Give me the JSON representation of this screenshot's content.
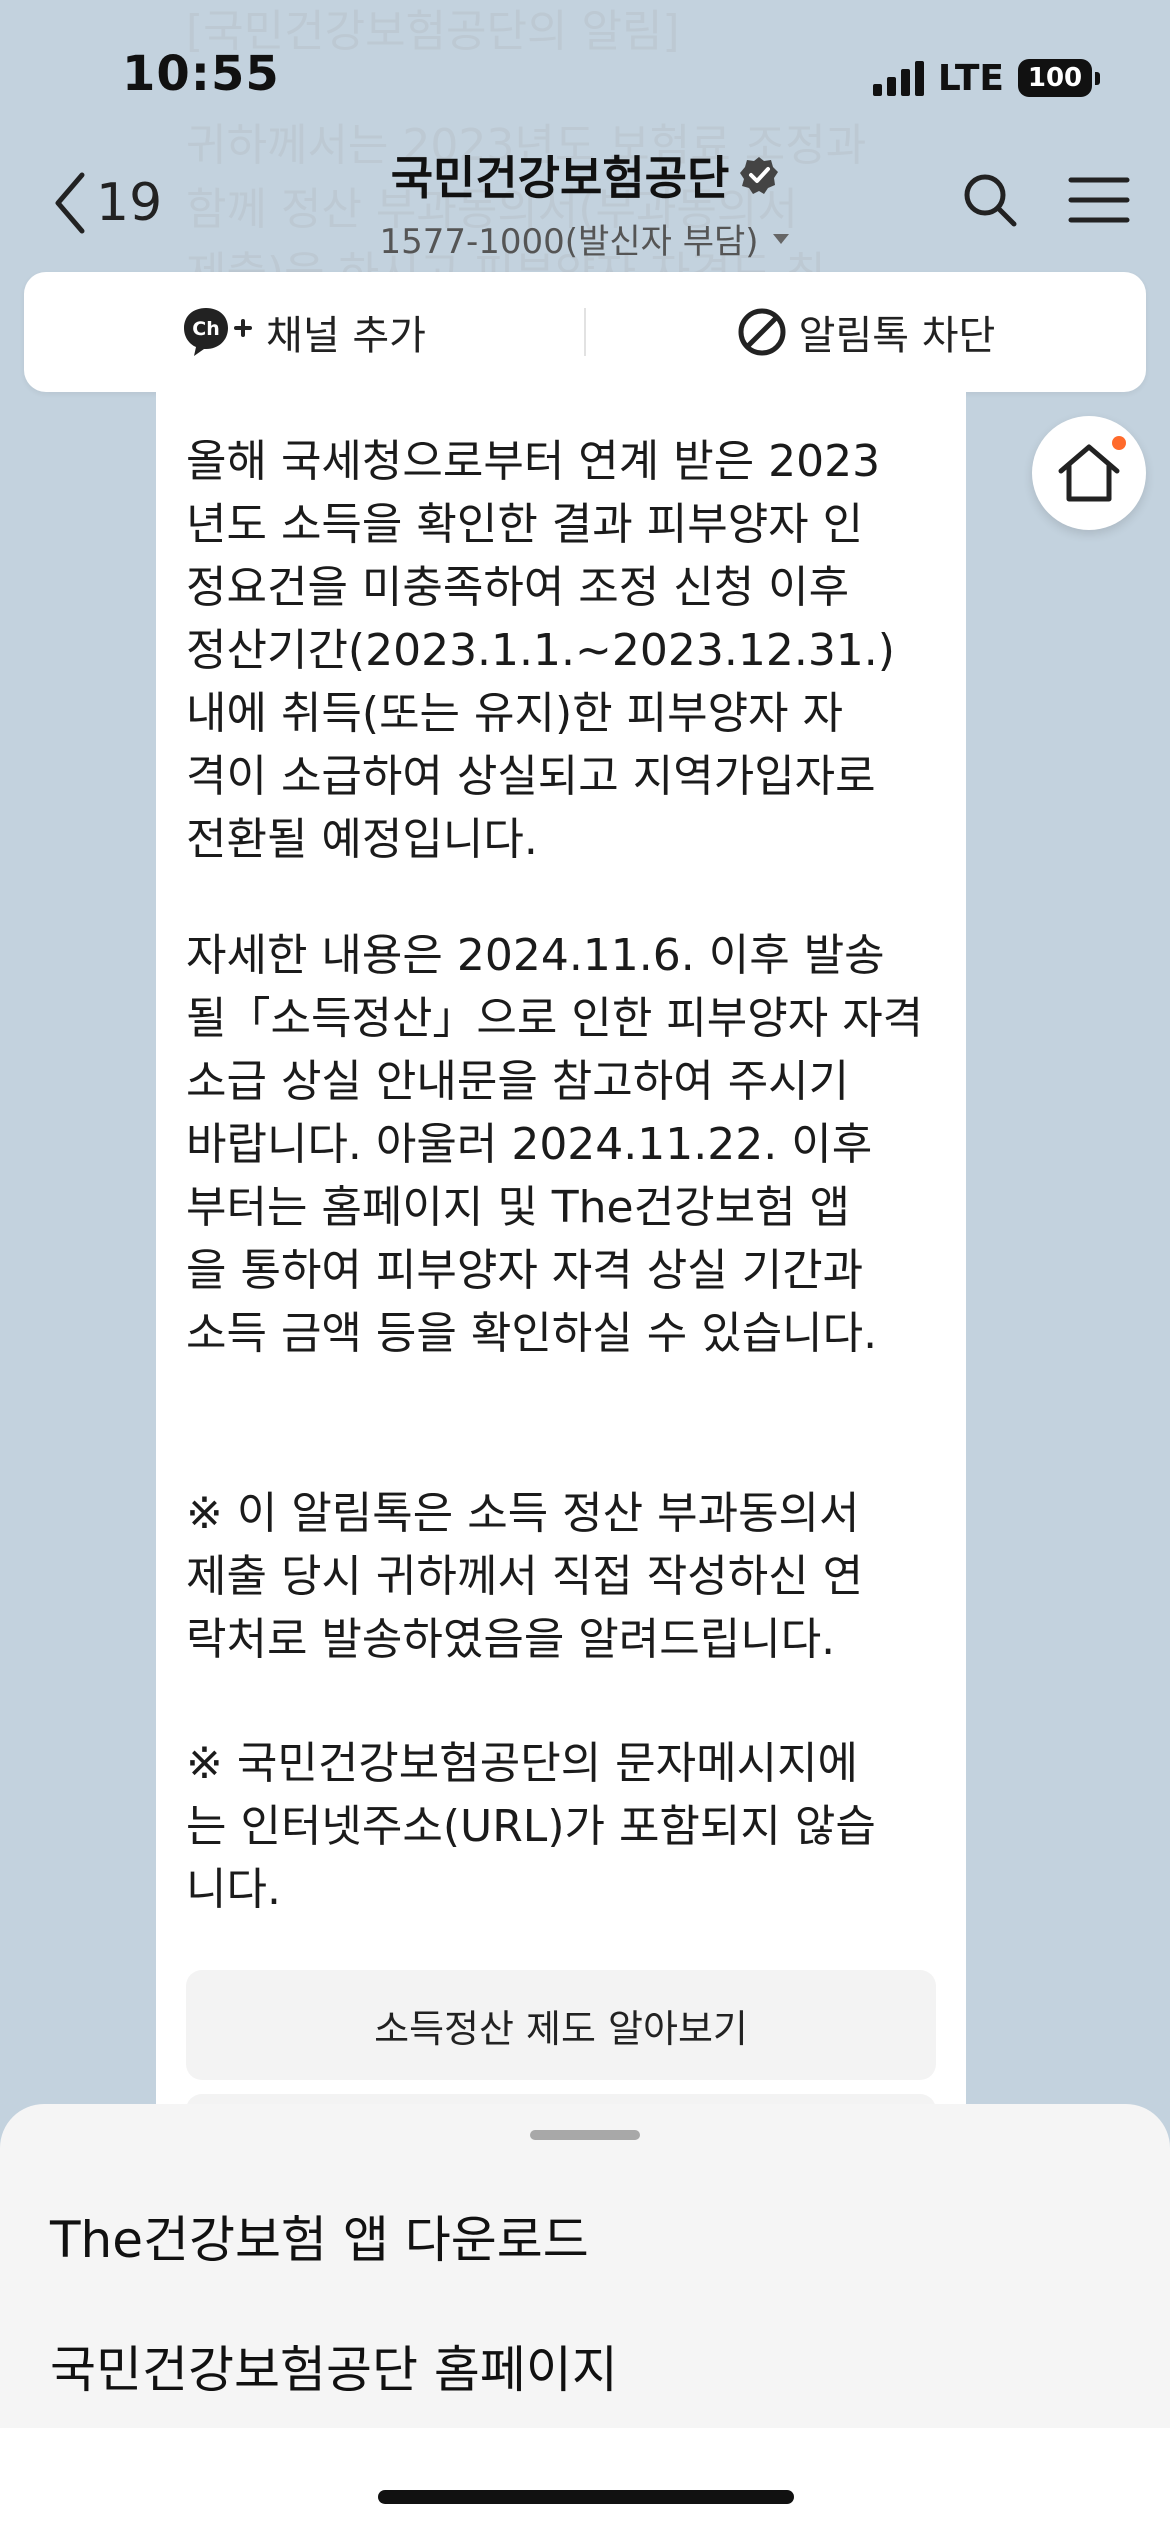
{
  "status": {
    "time": "10:55",
    "network": "LTE",
    "battery": "100"
  },
  "background_text": [
    "[국민건강보험공단의 알림]",
    "귀하께서는 2023년도 보험료 조정과",
    "함께 정산 부과동의서(부과동의서",
    "제출)을 하시고 피부양자 자격도 최"
  ],
  "header": {
    "back_count": "19",
    "channel_name": "국민건강보험공단",
    "channel_sub": "1577-1000(발신자 부담)"
  },
  "actions": {
    "add_channel": "채널 추가",
    "block_alimtalk": "알림톡 차단",
    "ch_icon_text": "Ch"
  },
  "message": {
    "para1": [
      "올해 국세청으로부터 연계 받은 2023",
      "년도 소득을 확인한 결과 피부양자 인",
      "정요건을 미충족하여 조정 신청 이후",
      "정산기간(2023.1.1.~2023.12.31.)",
      "내에 취득(또는 유지)한 피부양자 자",
      "격이 소급하여 상실되고 지역가입자로",
      " 전환될 예정입니다."
    ],
    "para2": [
      "자세한 내용은 2024.11.6. 이후 발송",
      "될「소득정산」으로 인한 피부양자 자격",
      " 소급 상실 안내문을 참고하여 주시기",
      "바랍니다. 아울러 2024.11.22. 이후",
      "부터는 홈페이지 및 The건강보험 앱",
      "을 통하여 피부양자 자격 상실 기간과",
      "소득 금액 등을 확인하실 수 있습니다."
    ],
    "para3": [
      "※ 이 알림톡은 소득 정산 부과동의서",
      "제출 당시 귀하께서 직접 작성하신 연",
      "락처로 발송하였음을 알려드립니다."
    ],
    "para4": [
      "※ 국민건강보험공단의 문자메시지에",
      "는 인터넷주소(URL)가 포함되지 않습",
      "니다."
    ],
    "button_label": "소득정산 제도 알아보기"
  },
  "sheet": {
    "items": [
      "The건강보험 앱 다운로드",
      "국민건강보험공단 홈페이지"
    ]
  }
}
